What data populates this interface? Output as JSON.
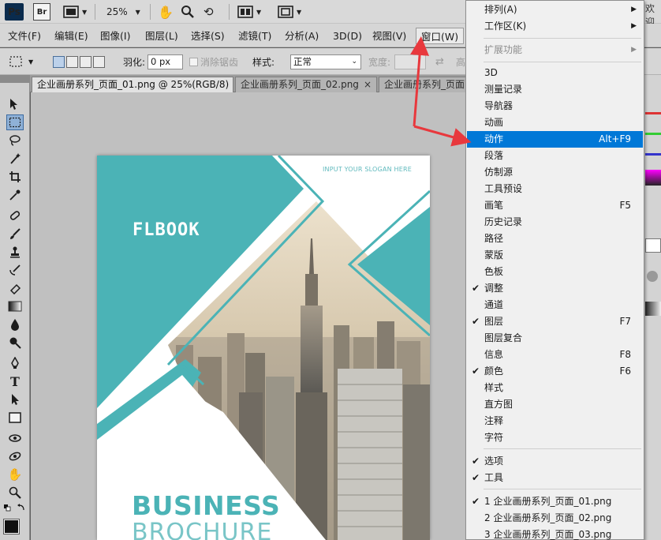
{
  "appbar": {
    "ps_label": "Ps",
    "br_label": "Br",
    "zoom": "25%",
    "top_right_text": "欢迎"
  },
  "menubar": {
    "items": [
      "文件(F)",
      "编辑(E)",
      "图像(I)",
      "图层(L)",
      "选择(S)",
      "滤镜(T)",
      "分析(A)",
      "3D(D)",
      "视图(V)",
      "窗口(W)"
    ]
  },
  "options": {
    "feather_label": "羽化:",
    "feather_value": "0 px",
    "antialias_label": "消除锯齿",
    "style_label": "样式:",
    "style_value": "正常",
    "width_label": "宽度:",
    "height_label": "高"
  },
  "tabs": [
    {
      "label": "企业画册系列_页面_01.png @ 25%(RGB/8)",
      "close": "×"
    },
    {
      "label": "企业画册系列_页面_02.png",
      "close": "×"
    },
    {
      "label": "企业画册系列_页面"
    }
  ],
  "document": {
    "slogan": "INPUT YOUR SLOGAN HERE",
    "brand": "FLBOOK",
    "headline_1": "BUSINESS",
    "headline_2": "BROCHURE",
    "accent_color": "#4bb3b6"
  },
  "window_menu": {
    "items": [
      {
        "label": "排列(A)",
        "submenu": true
      },
      {
        "label": "工作区(K)",
        "submenu": true
      },
      {
        "label": "扩展功能",
        "submenu": true,
        "disabled": true
      },
      {
        "label": "3D"
      },
      {
        "label": "测量记录"
      },
      {
        "label": "导航器"
      },
      {
        "label": "动画"
      },
      {
        "label": "动作",
        "shortcut": "Alt+F9",
        "highlighted": true
      },
      {
        "label": "段落"
      },
      {
        "label": "仿制源"
      },
      {
        "label": "工具预设"
      },
      {
        "label": "画笔",
        "shortcut": "F5"
      },
      {
        "label": "历史记录"
      },
      {
        "label": "路径"
      },
      {
        "label": "蒙版"
      },
      {
        "label": "色板"
      },
      {
        "label": "调整",
        "checked": true
      },
      {
        "label": "通道"
      },
      {
        "label": "图层",
        "shortcut": "F7",
        "checked": true
      },
      {
        "label": "图层复合"
      },
      {
        "label": "信息",
        "shortcut": "F8"
      },
      {
        "label": "颜色",
        "shortcut": "F6",
        "checked": true
      },
      {
        "label": "样式"
      },
      {
        "label": "直方图"
      },
      {
        "label": "注释"
      },
      {
        "label": "字符"
      },
      {
        "label": "选项",
        "checked": true
      },
      {
        "label": "工具",
        "checked": true
      },
      {
        "label": "1 企业画册系列_页面_01.png",
        "checked": true
      },
      {
        "label": "2 企业画册系列_页面_02.png"
      },
      {
        "label": "3 企业画册系列_页面_03.png"
      }
    ],
    "check_glyph": "✔",
    "submenu_glyph": "▶"
  },
  "colors": {
    "highlight": "#0078d7",
    "arrow": "#e8383d",
    "teal": "#4bb3b6"
  }
}
